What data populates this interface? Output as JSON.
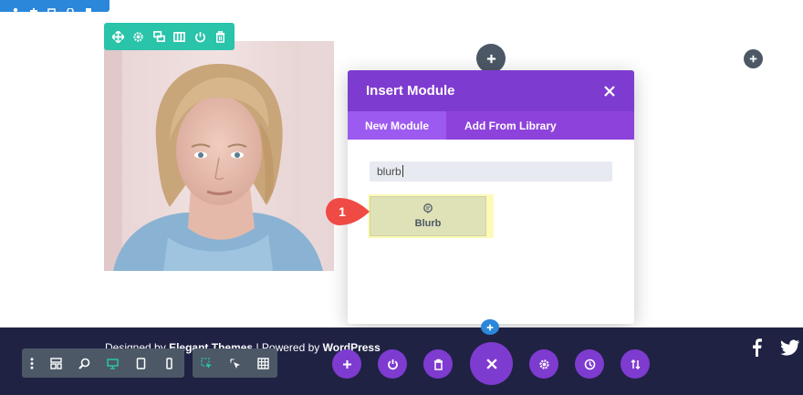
{
  "section_toolbar": {
    "icons": [
      "gear-icon",
      "move-icon",
      "duplicate-icon",
      "power-icon",
      "trash-icon"
    ]
  },
  "module_toolbar": {
    "icons": [
      "move-icon",
      "gear-icon",
      "duplicate-icon",
      "columns-icon",
      "power-icon",
      "trash-icon"
    ]
  },
  "insert_module": {
    "title": "Insert Module",
    "tabs": [
      "New Module",
      "Add From Library"
    ],
    "active_tab": "New Module",
    "search_value": "blurb",
    "result": {
      "label": "Blurb",
      "icon": "blurb-icon"
    }
  },
  "callout": {
    "number": "1"
  },
  "footer": {
    "designed_by": "Designed by",
    "elegant_themes": "Elegant Themes",
    "separator": "|",
    "powered_by": "Powered by",
    "wordpress": "WordPress",
    "social": [
      "facebook-icon",
      "twitter-icon"
    ]
  },
  "bottom_bar": {
    "left_group": [
      "more-icon",
      "wireframe-icon",
      "zoom-icon",
      "desktop-icon",
      "tablet-icon",
      "phone-icon"
    ],
    "right_group": [
      "click-select-icon",
      "hover-icon",
      "grid-icon"
    ],
    "center_buttons": [
      "add-icon",
      "power-icon",
      "trash-icon",
      "close-icon",
      "gear-icon",
      "history-icon",
      "sort-icon"
    ]
  },
  "colors": {
    "purple": "#7e3bd0",
    "teal": "#29c4a9",
    "blue": "#2b87da",
    "slate": "#4c5866",
    "footer_bg": "#1f2243",
    "callout_red": "#ef4a44"
  }
}
